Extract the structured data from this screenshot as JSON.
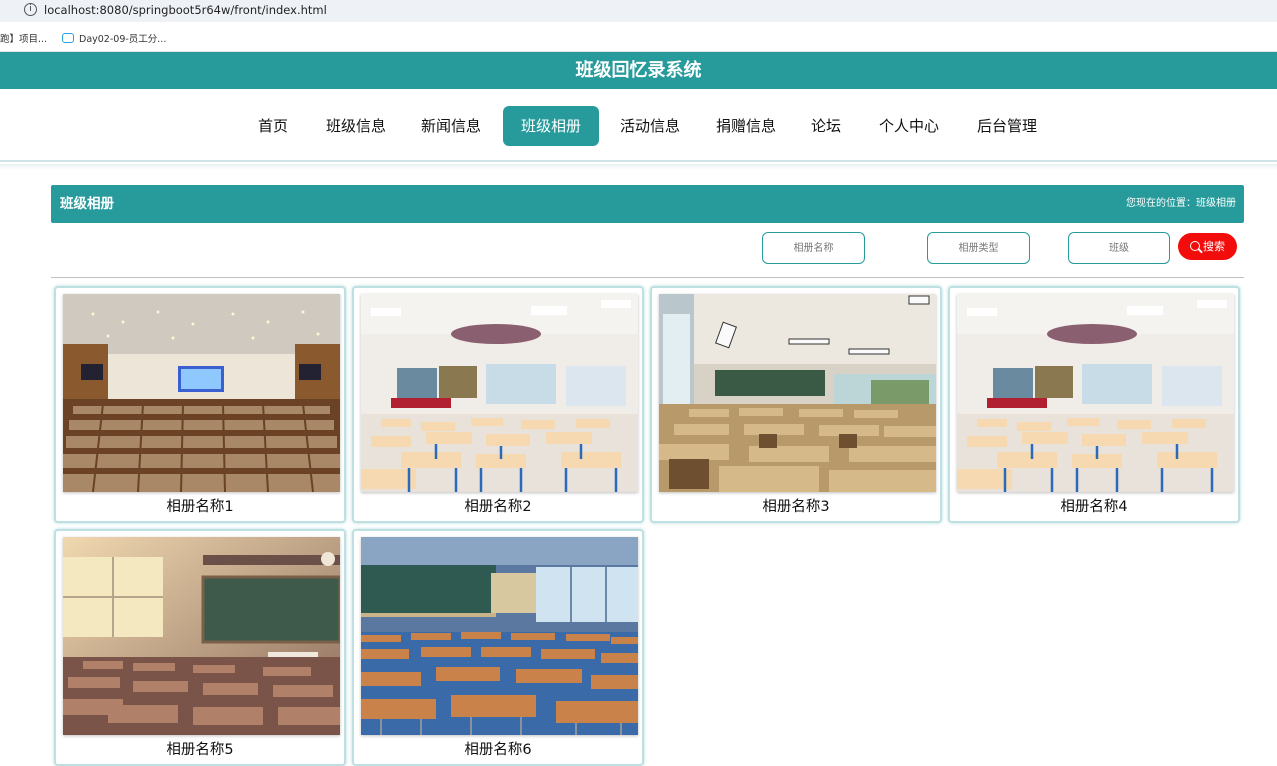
{
  "browser": {
    "url": "localhost:8080/springboot5r64w/front/index.html",
    "bookmarks": [
      "跑】项目...",
      "Day02-09-员工分..."
    ]
  },
  "header": {
    "title": "班级回忆录系统"
  },
  "nav": {
    "items": [
      "首页",
      "班级信息",
      "新闻信息",
      "班级相册",
      "活动信息",
      "捐赠信息",
      "论坛",
      "个人中心",
      "后台管理"
    ],
    "active": "班级相册"
  },
  "section": {
    "title": "班级相册",
    "breadcrumb": "您现在的位置：班级相册"
  },
  "search": {
    "album_name_placeholder": "相册名称",
    "album_type_placeholder": "相册类型",
    "class_placeholder": "班级",
    "button_label": "搜索"
  },
  "albums": [
    {
      "name": "相册名称1",
      "scene": "auditorium"
    },
    {
      "name": "相册名称2",
      "scene": "classroom-bright"
    },
    {
      "name": "相册名称3",
      "scene": "classroom-wood"
    },
    {
      "name": "相册名称4",
      "scene": "classroom-bright"
    },
    {
      "name": "相册名称5",
      "scene": "classroom-sunset"
    },
    {
      "name": "相册名称6",
      "scene": "classroom-anime"
    }
  ],
  "colors": {
    "primary": "#279b9b",
    "search_button": "#f20c0c"
  }
}
